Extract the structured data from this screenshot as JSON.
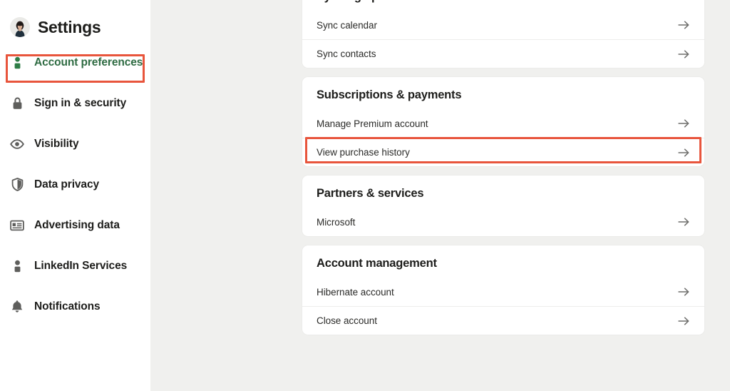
{
  "sidebar": {
    "avatar_icon": "user-avatar-photo",
    "title": "Settings",
    "items": [
      {
        "label": "Account preferences",
        "icon": "person-icon",
        "selected": true
      },
      {
        "label": "Sign in & security",
        "icon": "lock-icon",
        "selected": false
      },
      {
        "label": "Visibility",
        "icon": "eye-icon",
        "selected": false
      },
      {
        "label": "Data privacy",
        "icon": "shield-icon",
        "selected": false
      },
      {
        "label": "Advertising data",
        "icon": "ad-card-icon",
        "selected": false
      },
      {
        "label": "LinkedIn Services",
        "icon": "person-icon",
        "selected": false
      },
      {
        "label": "Notifications",
        "icon": "bell-icon",
        "selected": false
      }
    ]
  },
  "main": {
    "cards": [
      {
        "title": "Syncing options",
        "rows": [
          {
            "label": "Sync calendar",
            "arrow_icon": "arrow-right-icon",
            "highlighted": false
          },
          {
            "label": "Sync contacts",
            "arrow_icon": "arrow-right-icon",
            "highlighted": false
          }
        ]
      },
      {
        "title": "Subscriptions & payments",
        "rows": [
          {
            "label": "Manage Premium account",
            "arrow_icon": "arrow-right-icon",
            "highlighted": true
          },
          {
            "label": "View purchase history",
            "arrow_icon": "arrow-right-icon",
            "highlighted": false
          }
        ]
      },
      {
        "title": "Partners & services",
        "rows": [
          {
            "label": "Microsoft",
            "arrow_icon": "arrow-right-icon",
            "highlighted": false
          }
        ]
      },
      {
        "title": "Account management",
        "rows": [
          {
            "label": "Hibernate account",
            "arrow_icon": "arrow-right-icon",
            "highlighted": false
          },
          {
            "label": "Close account",
            "arrow_icon": "arrow-right-icon",
            "highlighted": false
          }
        ]
      }
    ]
  },
  "colors": {
    "highlight_red": "#E8553C",
    "selected_green": "#2E6B42",
    "page_background": "#F0F0EE",
    "card_background": "#FFFFFF",
    "text_primary": "#1D1D1B",
    "icon_gray": "#5E5E5C"
  }
}
